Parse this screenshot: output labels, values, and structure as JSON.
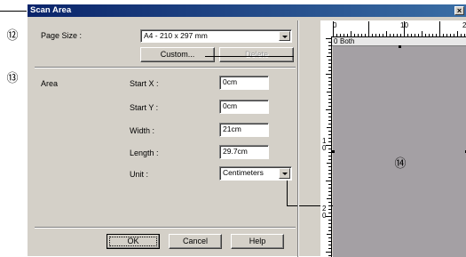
{
  "window": {
    "title": "Scan Area",
    "close_symbol": "×"
  },
  "callouts": {
    "page_size": "⑫",
    "area": "⑬",
    "preview": "⑭"
  },
  "page_size": {
    "label": "Page Size :",
    "value": "A4 - 210 x 297 mm"
  },
  "buttons": {
    "custom": "Custom...",
    "delete": "Delete",
    "ok": "OK",
    "cancel": "Cancel",
    "help": "Help"
  },
  "area": {
    "label": "Area",
    "start_x_label": "Start X :",
    "start_x_value": "0cm",
    "start_y_label": "Start Y :",
    "start_y_value": "0cm",
    "width_label": "Width :",
    "width_value": "21cm",
    "length_label": "Length :",
    "length_value": "29.7cm",
    "unit_label": "Unit :",
    "unit_value": "Centimeters"
  },
  "preview": {
    "ruler_top_labels": [
      "0",
      "10",
      "2"
    ],
    "ruler_left_labels": [
      "1\n0",
      "2\n0"
    ],
    "header_zero": "0",
    "header_mode": "Both"
  }
}
